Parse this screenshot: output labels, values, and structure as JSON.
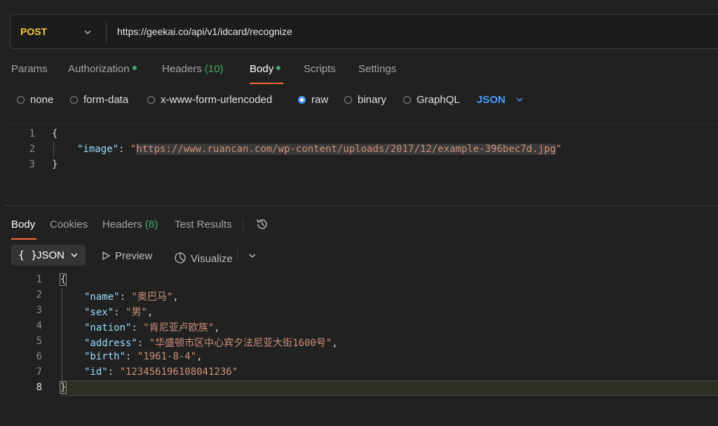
{
  "request": {
    "method": "POST",
    "url": "https://geekai.co/api/v1/idcard/recognize",
    "tabs": [
      {
        "label": "Params"
      },
      {
        "label": "Authorization"
      },
      {
        "label": "Headers",
        "count": "(10)"
      },
      {
        "label": "Body"
      },
      {
        "label": "Scripts"
      },
      {
        "label": "Settings"
      }
    ],
    "body_types": [
      "none",
      "form-data",
      "x-www-form-urlencoded",
      "raw",
      "binary",
      "GraphQL"
    ],
    "selected_body_type": "raw",
    "format": "JSON",
    "code_lines": {
      "l1": "{",
      "l2_key": "\"image\"",
      "l2_sep": ": ",
      "l2_q1": "\"",
      "l2_url": "https://www.ruancan.com/wp-content/uploads/2017/12/example-396bec7d.jpg",
      "l2_q2": "\"",
      "l3": "}"
    },
    "line_numbers": [
      "1",
      "2",
      "3"
    ]
  },
  "response": {
    "tabs": [
      {
        "label": "Body"
      },
      {
        "label": "Cookies"
      },
      {
        "label": "Headers",
        "count": "(8)"
      },
      {
        "label": "Test Results"
      }
    ],
    "format_button": {
      "braces": "{ }",
      "label": "JSON"
    },
    "preview_label": "Preview",
    "visualize_label": "Visualize",
    "line_numbers": [
      "1",
      "2",
      "3",
      "4",
      "5",
      "6",
      "7",
      "8"
    ],
    "json": {
      "open": "{",
      "close": "}",
      "fields": [
        {
          "key": "\"name\"",
          "value": "\"奥巴马\"",
          "comma": ","
        },
        {
          "key": "\"sex\"",
          "value": "\"男\"",
          "comma": ","
        },
        {
          "key": "\"nation\"",
          "value": "\"肯尼亚卢欧族\"",
          "comma": ","
        },
        {
          "key": "\"address\"",
          "value": "\"华盛顿市区中心宾夕法尼亚大街1600号\"",
          "comma": ","
        },
        {
          "key": "\"birth\"",
          "value": "\"1961-8-4\"",
          "comma": ","
        },
        {
          "key": "\"id\"",
          "value": "\"123456196108041236\"",
          "comma": ""
        }
      ]
    }
  },
  "colors": {
    "accent": "#ff6c37",
    "method": "#f5c542",
    "json_select": "#4a9bff",
    "status_dot": "#3fae6a"
  }
}
